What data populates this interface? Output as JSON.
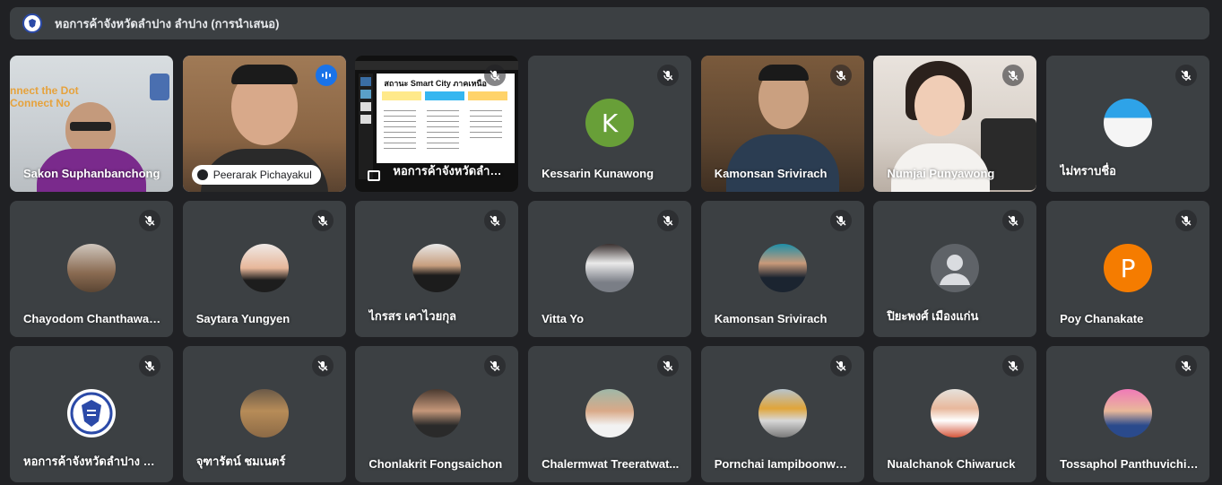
{
  "meeting": {
    "title": "หอการค้าจังหวัดลำปาง ลำปาง (การนำเสนอ)"
  },
  "presentation": {
    "slide_title": "สถานะ Smart City ภาคเหนือ",
    "caption": "หอการค้าจังหวัดลำปาง"
  },
  "banner_text": {
    "line1": "nnect the Dot",
    "line2": "Connect No"
  },
  "colors": {
    "background": "#202124",
    "tile": "#3c4043",
    "speaking_outline": "#8ab4f8",
    "avatar_k": "#689f38",
    "avatar_p": "#f57c00",
    "avatar_default": "#5f6368"
  },
  "participants": [
    {
      "name": "Sakon Suphanbanchong",
      "kind": "video"
    },
    {
      "name": "Peerarak Pichayakul",
      "kind": "video-speaking"
    },
    {
      "name": "หอการค้าจังหวัดลำปา...",
      "kind": "presentation"
    },
    {
      "name": "Kessarin Kunawong",
      "kind": "letter",
      "letter": "K"
    },
    {
      "name": "Kamonsan Srivirach",
      "kind": "video"
    },
    {
      "name": "Numjai Punyawong",
      "kind": "video"
    },
    {
      "name": "ไม่ทราบชื่อ",
      "kind": "photo"
    },
    {
      "name": "Chayodom Chanthawar...",
      "kind": "photo"
    },
    {
      "name": "Saytara Yungyen",
      "kind": "photo"
    },
    {
      "name": "ไกรสร เคาไวยกุล",
      "kind": "photo"
    },
    {
      "name": "Vitta Yo",
      "kind": "photo"
    },
    {
      "name": "Kamonsan Srivirach",
      "kind": "photo"
    },
    {
      "name": "ปิยะพงศ์ เมืองแก่น",
      "kind": "default"
    },
    {
      "name": "Poy Chanakate",
      "kind": "letter",
      "letter": "P"
    },
    {
      "name": "หอการค้าจังหวัดลำปาง ลำ...",
      "kind": "logo"
    },
    {
      "name": "จุฑารัตน์ ชมเนตร์",
      "kind": "photo"
    },
    {
      "name": "Chonlakrit Fongsaichon",
      "kind": "photo"
    },
    {
      "name": "Chalermwat Treeratwat...",
      "kind": "photo"
    },
    {
      "name": "Pornchai Iampiboonwat...",
      "kind": "photo"
    },
    {
      "name": "Nualchanok Chiwaruck",
      "kind": "photo"
    },
    {
      "name": "Tossaphol Panthuvichien",
      "kind": "photo"
    }
  ]
}
